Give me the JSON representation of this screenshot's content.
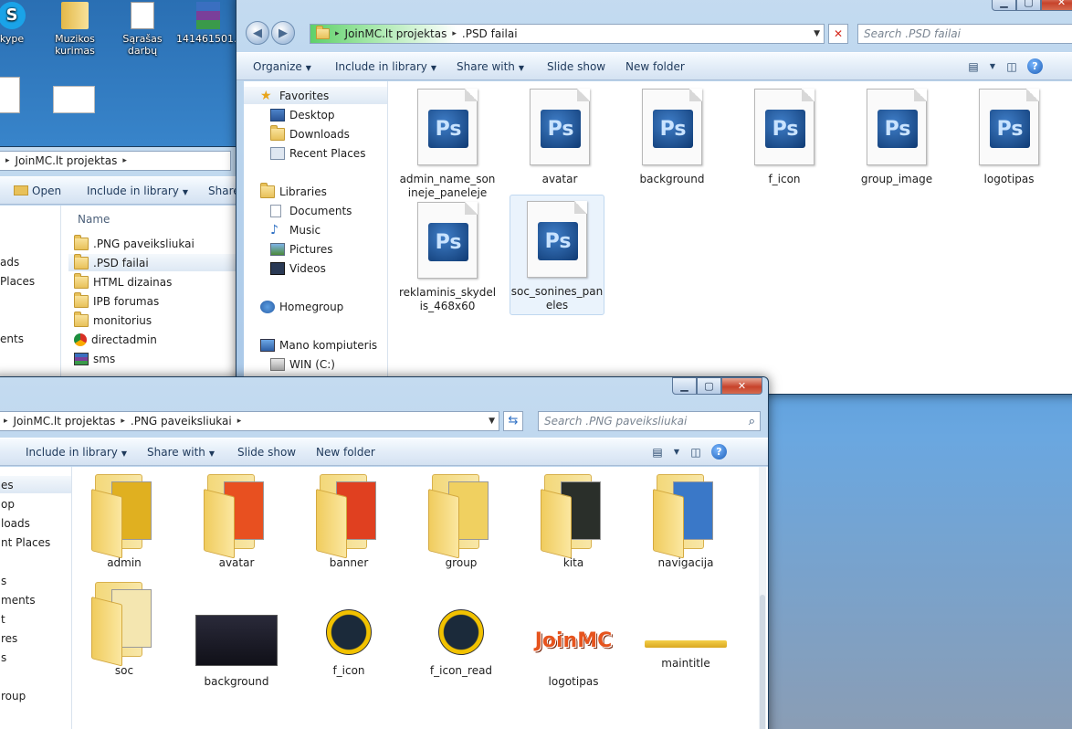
{
  "desktop": {
    "icons": [
      {
        "label": "kype",
        "icon": "skype-icon",
        "color": "#1aa3e8"
      },
      {
        "label": "Muzikos kurimas",
        "icon": "folder-icon",
        "color": "#f0cc5e"
      },
      {
        "label": "Sąrašas darbų",
        "icon": "text-document-icon",
        "color": "#ffffff"
      },
      {
        "label": "141461501...",
        "icon": "winrar-archive-icon",
        "color": "#7a3f9a"
      }
    ]
  },
  "back_window": {
    "address_crumbs": [
      "JoinMC.lt projektas",
      ".PSD failai"
    ],
    "search_placeholder": "Search .PSD failai",
    "toolbar": {
      "organize": "Organize",
      "include_in_library": "Include in library",
      "share_with": "Share with",
      "slide_show": "Slide show",
      "new_folder": "New folder"
    },
    "nav": {
      "favorites": "Favorites",
      "desktop": "Desktop",
      "downloads": "Downloads",
      "recent_places": "Recent Places",
      "libraries": "Libraries",
      "documents": "Documents",
      "music": "Music",
      "pictures": "Pictures",
      "videos": "Videos",
      "homegroup": "Homegroup",
      "computer": "Mano kompiuteris",
      "drive_c": "WIN (C:)"
    },
    "files": [
      {
        "name": "admin_name_son ineje_paneleje",
        "icon": "photoshop-file-icon"
      },
      {
        "name": "avatar",
        "icon": "photoshop-file-icon"
      },
      {
        "name": "background",
        "icon": "photoshop-file-icon"
      },
      {
        "name": "f_icon",
        "icon": "photoshop-file-icon"
      },
      {
        "name": "group_image",
        "icon": "photoshop-file-icon"
      },
      {
        "name": "logotipas",
        "icon": "photoshop-file-icon"
      },
      {
        "name": "reklaminis_skydel is_468x60",
        "icon": "photoshop-file-icon"
      },
      {
        "name": "soc_sonines_pan eles",
        "icon": "photoshop-file-icon"
      }
    ],
    "ps_label": "Ps"
  },
  "left_window": {
    "address_crumbs": [
      "JoinMC.lt projektas"
    ],
    "toolbar": {
      "open": "Open",
      "include_in_library": "Include in library",
      "share": "Share"
    },
    "column_name": "Name",
    "nav_partial": [
      "ads",
      "Places",
      "ents"
    ],
    "items": [
      {
        "name": ".PNG paveiksliukai",
        "icon": "folder-icon"
      },
      {
        "name": ".PSD failai",
        "icon": "folder-icon",
        "selected": true
      },
      {
        "name": "HTML dizainas",
        "icon": "folder-icon"
      },
      {
        "name": "IPB forumas",
        "icon": "folder-icon"
      },
      {
        "name": "monitorius",
        "icon": "folder-icon"
      },
      {
        "name": "directadmin",
        "icon": "chrome-shortcut-icon"
      },
      {
        "name": "sms",
        "icon": "winrar-archive-icon"
      }
    ]
  },
  "front_window": {
    "address_crumbs": [
      "JoinMC.lt projektas",
      ".PNG paveiksliukai"
    ],
    "search_placeholder": "Search .PNG paveiksliukai",
    "toolbar": {
      "include_in_library": "Include in library",
      "share_with": "Share with",
      "slide_show": "Slide show",
      "new_folder": "New folder"
    },
    "nav_partial": [
      "es",
      "op",
      "loads",
      "nt Places",
      "s",
      "ments",
      "t",
      "res",
      "s",
      "roup"
    ],
    "folders": [
      {
        "name": "admin",
        "paper": "#e0b020"
      },
      {
        "name": "avatar",
        "paper": "#e85020"
      },
      {
        "name": "banner",
        "paper": "#e04020"
      },
      {
        "name": "group",
        "paper": "#f0d060"
      },
      {
        "name": "kita",
        "paper": "#2a2f2a"
      },
      {
        "name": "navigacija",
        "paper": "#3a78c8"
      },
      {
        "name": "soc",
        "paper": "#f4e6b0"
      }
    ],
    "images": [
      {
        "name": "background",
        "kind": "dark-scene"
      },
      {
        "name": "f_icon",
        "kind": "round-icon"
      },
      {
        "name": "f_icon_read",
        "kind": "round-icon"
      },
      {
        "name": "logotipas",
        "kind": "logo"
      },
      {
        "name": "maintitle",
        "kind": "bar"
      }
    ],
    "logo_text": "JoinMC"
  }
}
